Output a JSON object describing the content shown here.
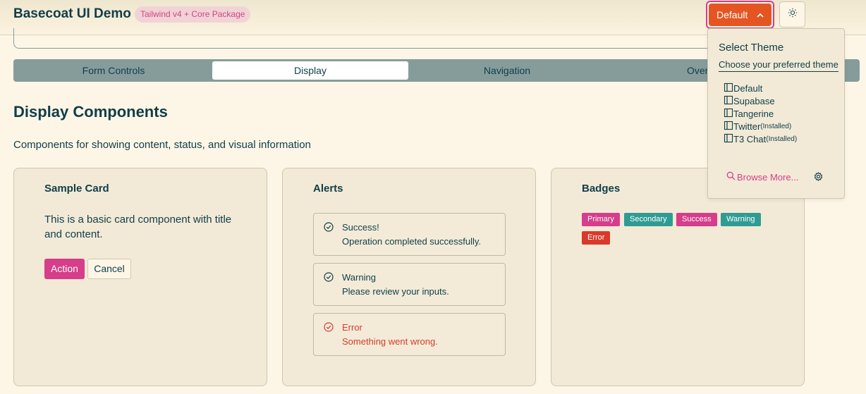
{
  "header": {
    "title": "Basecoat UI Demo",
    "badge": "Tailwind v4 + Core Package",
    "theme_button_label": "Default"
  },
  "tabs": [
    {
      "label": "Form Controls"
    },
    {
      "label": "Display"
    },
    {
      "label": "Navigation"
    },
    {
      "label": "Overl"
    }
  ],
  "main": {
    "title": "Display Components",
    "subtitle": "Components for showing content, status, and visual information"
  },
  "sample_card": {
    "title": "Sample Card",
    "text": "This is a basic card component with title and content.",
    "action_label": "Action",
    "cancel_label": "Cancel"
  },
  "alerts": {
    "title": "Alerts",
    "items": [
      {
        "title": "Success!",
        "desc": "Operation completed successfully."
      },
      {
        "title": "Warning",
        "desc": "Please review your inputs."
      },
      {
        "title": "Error",
        "desc": "Something went wrong."
      }
    ]
  },
  "badges": {
    "title": "Badges",
    "items": [
      {
        "label": "Primary",
        "color": "#d63d8a"
      },
      {
        "label": "Secondary",
        "color": "#2f9c94"
      },
      {
        "label": "Success",
        "color": "#d63d8a"
      },
      {
        "label": "Warning",
        "color": "#2f9c94"
      },
      {
        "label": "Error",
        "color": "#d93a2b"
      }
    ]
  },
  "theme_menu": {
    "title": "Select Theme",
    "description": "Choose your preferred theme",
    "items": [
      {
        "label": "Default",
        "note": ""
      },
      {
        "label": "Supabase",
        "note": ""
      },
      {
        "label": "Tangerine",
        "note": ""
      },
      {
        "label": "Twitter",
        "note": "(Installed)"
      },
      {
        "label": "T3 Chat",
        "note": "(Installed)"
      }
    ],
    "browse_label": "Browse More..."
  },
  "colors": {
    "background": "#fdf6e6",
    "primary": "#d63d8a",
    "accent_orange": "#e45522",
    "teal": "#2f9c94",
    "destructive": "#d93a2b",
    "text": "#103d4a"
  }
}
